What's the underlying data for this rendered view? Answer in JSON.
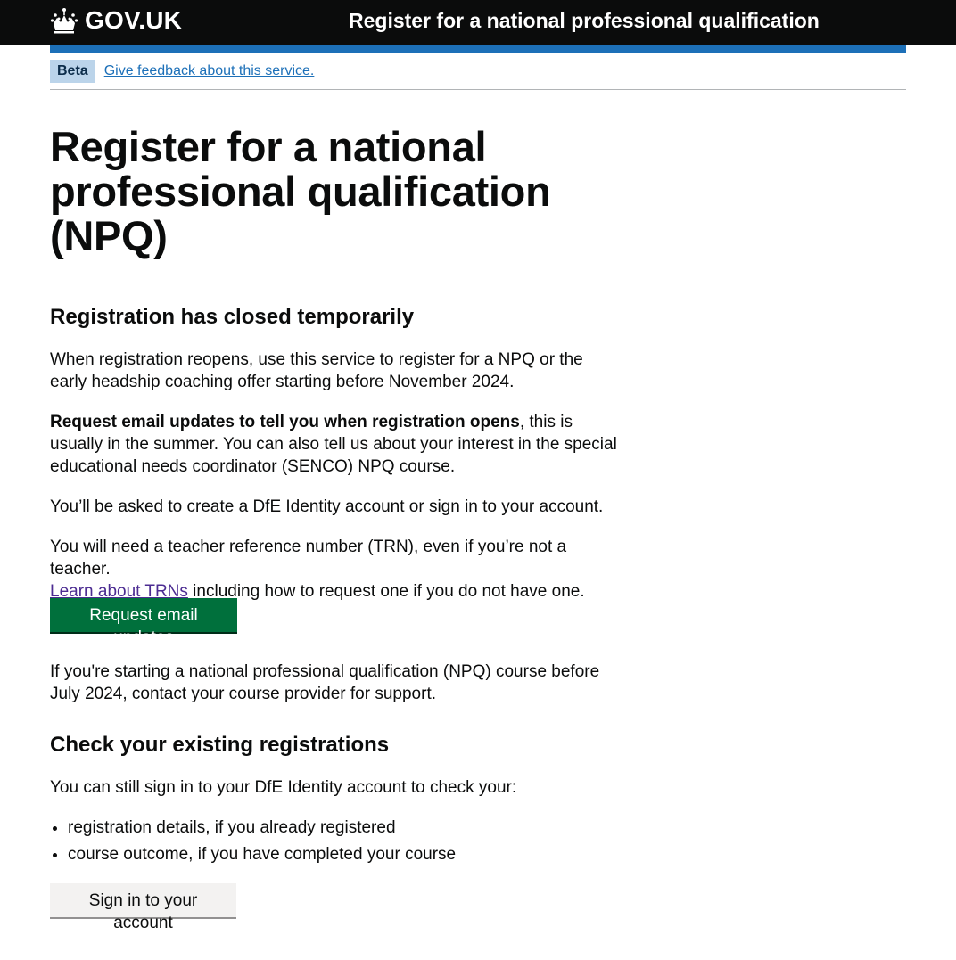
{
  "header": {
    "logo_text": "GOV.UK",
    "service_name": "Register for a national professional qualification"
  },
  "phase_banner": {
    "tag": "Beta",
    "feedback_link": "Give feedback about this service."
  },
  "main": {
    "title": "Register for a national professional qualification (NPQ)",
    "section1_heading": "Registration has closed temporarily",
    "p1": "When registration reopens, use this service to register for a NPQ or the early headship coaching offer starting before November 2024.",
    "p2_bold": "Request email updates to tell you when registration opens",
    "p2_rest": ", this is usually in the summer. You can also tell us about your interest in the special educational needs coordinator (SENCO) NPQ course.",
    "p3": "You’ll be asked to create a DfE Identity account or sign in to your account.",
    "p4_text": "You will need a teacher reference number (TRN), even if you’re not a teacher.",
    "p4_link": "Learn about TRNs",
    "p4_after": " including how to request one if you do not have one.",
    "primary_button": "Request email updates",
    "p5": "If you're starting a national professional qualification (NPQ) course before July 2024, contact your course provider for support.",
    "section2_heading": "Check your existing registrations",
    "p6": "You can still sign in to your DfE Identity account to check your:",
    "list_items": [
      "registration details, if you already registered",
      "course outcome, if you have completed your course"
    ],
    "secondary_button": "Sign in to your account"
  },
  "colors": {
    "header_bg": "#0b0c0c",
    "brand_blue": "#1d70b8",
    "button_green": "#00703c",
    "visited_link": "#4c2c92"
  },
  "icons": [
    "crown-icon"
  ]
}
